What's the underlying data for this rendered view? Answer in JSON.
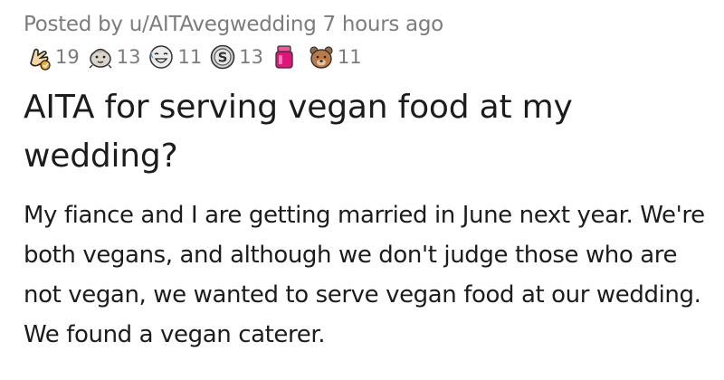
{
  "post": {
    "posted_by_prefix": "Posted by ",
    "username": "u/AITAvegwedding",
    "time_ago": " 7 hours ago",
    "awards": [
      {
        "icon": "helpful-hand-icon",
        "count": "19"
      },
      {
        "icon": "wholesome-seal-icon",
        "count": "13"
      },
      {
        "icon": "laughing-face-icon",
        "count": "11"
      },
      {
        "icon": "silver-coin-icon",
        "count": "13"
      },
      {
        "icon": "pink-jar-icon",
        "count": ""
      },
      {
        "icon": "bear-icon",
        "count": "11"
      }
    ],
    "title": "AITA for serving vegan food at my wedding?",
    "body": "My fiance and I are getting married in June next year. We're both vegans, and although we don't judge those who are not vegan, we wanted to serve vegan food at our wedding. We found a vegan caterer."
  }
}
